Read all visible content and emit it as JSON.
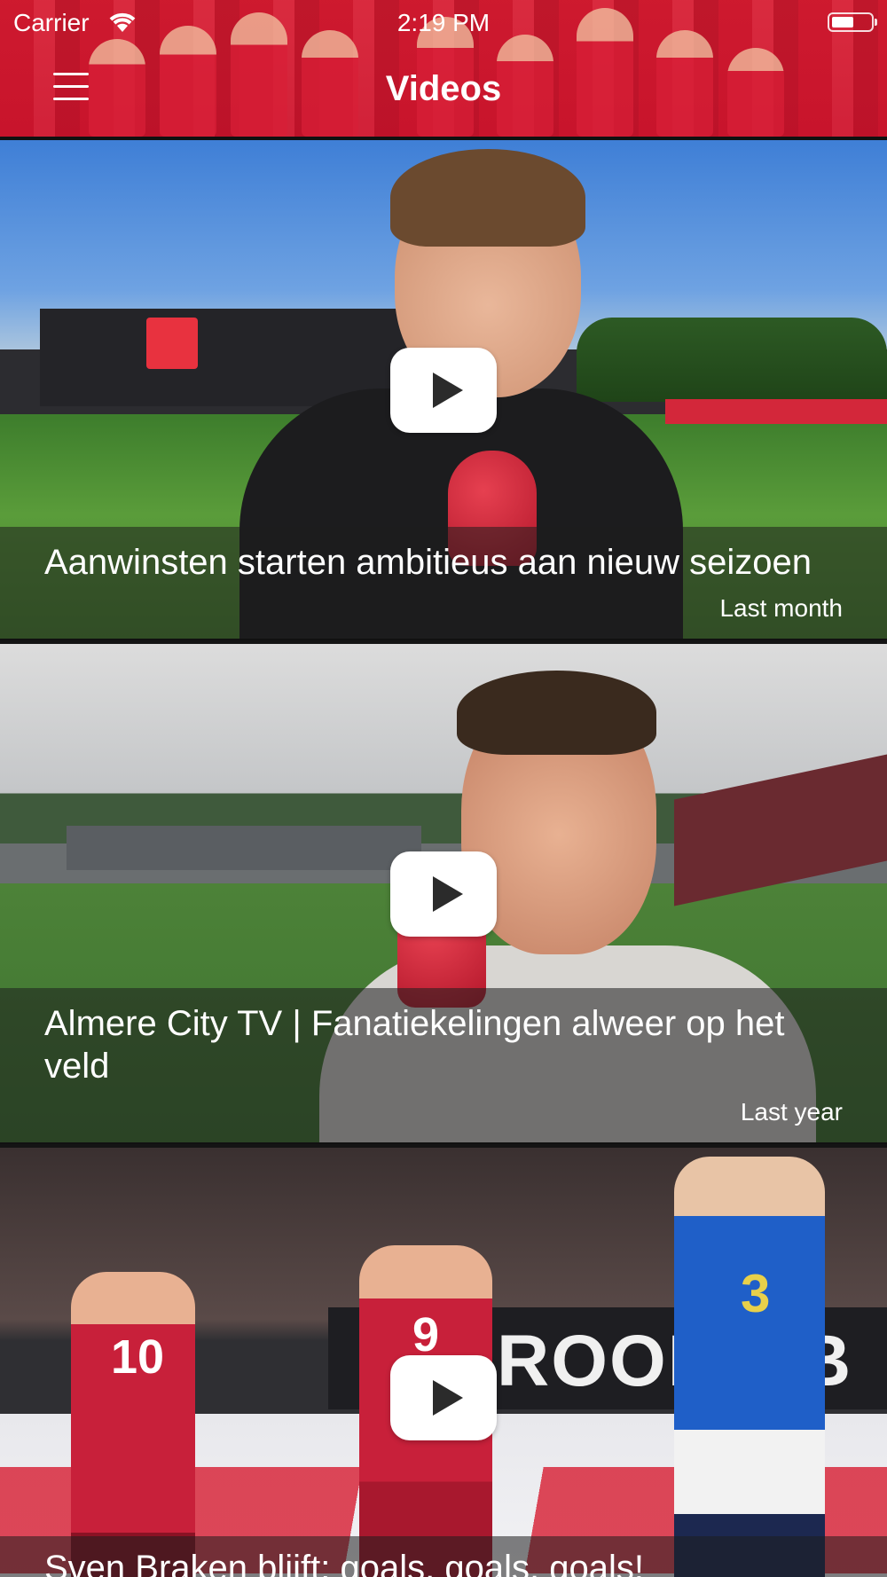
{
  "status_bar": {
    "carrier": "Carrier",
    "time": "2:19 PM"
  },
  "header": {
    "title": "Videos",
    "menu_icon": "hamburger-menu-icon"
  },
  "videos": [
    {
      "title": "Aanwinsten starten ambitieus aan nieuw seizoen",
      "date": "Last month",
      "play_icon": "play-icon"
    },
    {
      "title": "Almere City TV | Fanatiekelingen alweer op het veld",
      "date": "Last year",
      "play_icon": "play-icon"
    },
    {
      "title": "Sven Braken blijft: goals, goals, goals!",
      "date": "",
      "play_icon": "play-icon"
    }
  ],
  "colors": {
    "header_tint": "#d21e32",
    "caption_overlay": "rgba(30,30,30,0.55)",
    "play_button": "#ffffff"
  }
}
